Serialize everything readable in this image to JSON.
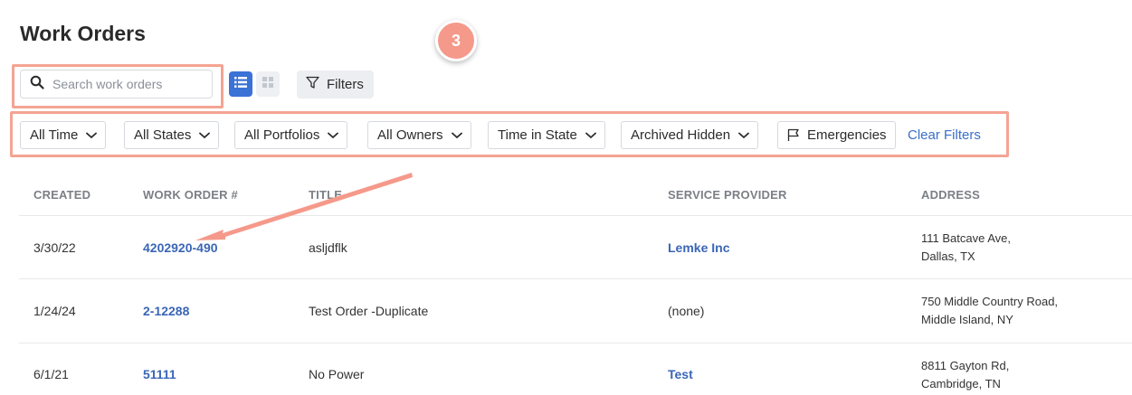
{
  "page": {
    "title": "Work Orders"
  },
  "annotation": {
    "step_number": "3",
    "accent_color": "#f5998a"
  },
  "toolbar": {
    "search_placeholder": "Search work orders",
    "search_value": "",
    "list_view_icon": "list-icon",
    "grid_view_icon": "grid-icon",
    "filters_label": "Filters"
  },
  "filter_bar": {
    "time": "All Time",
    "states": "All States",
    "portfolios": "All Portfolios",
    "owners": "All Owners",
    "time_in_state": "Time in State",
    "archived": "Archived Hidden",
    "emergencies": "Emergencies",
    "clear": "Clear Filters"
  },
  "table": {
    "headers": {
      "created": "CREATED",
      "work_order": "WORK ORDER #",
      "title": "TITLE",
      "service_provider": "SERVICE PROVIDER",
      "address": "ADDRESS"
    },
    "rows": [
      {
        "created": "3/30/22",
        "work_order": "4202920-490",
        "title": "asljdflk",
        "service_provider": "Lemke Inc",
        "address_line1": "111 Batcave Ave,",
        "address_line2": "Dallas, TX"
      },
      {
        "created": "1/24/24",
        "work_order": "2-12288",
        "title": "Test Order -Duplicate",
        "service_provider": "(none)",
        "address_line1": "750 Middle Country Road,",
        "address_line2": "Middle Island, NY"
      },
      {
        "created": "6/1/21",
        "work_order": "51111",
        "title": "No Power",
        "service_provider": "Test",
        "address_line1": "8811 Gayton Rd,",
        "address_line2": "Cambridge, TN"
      }
    ]
  }
}
